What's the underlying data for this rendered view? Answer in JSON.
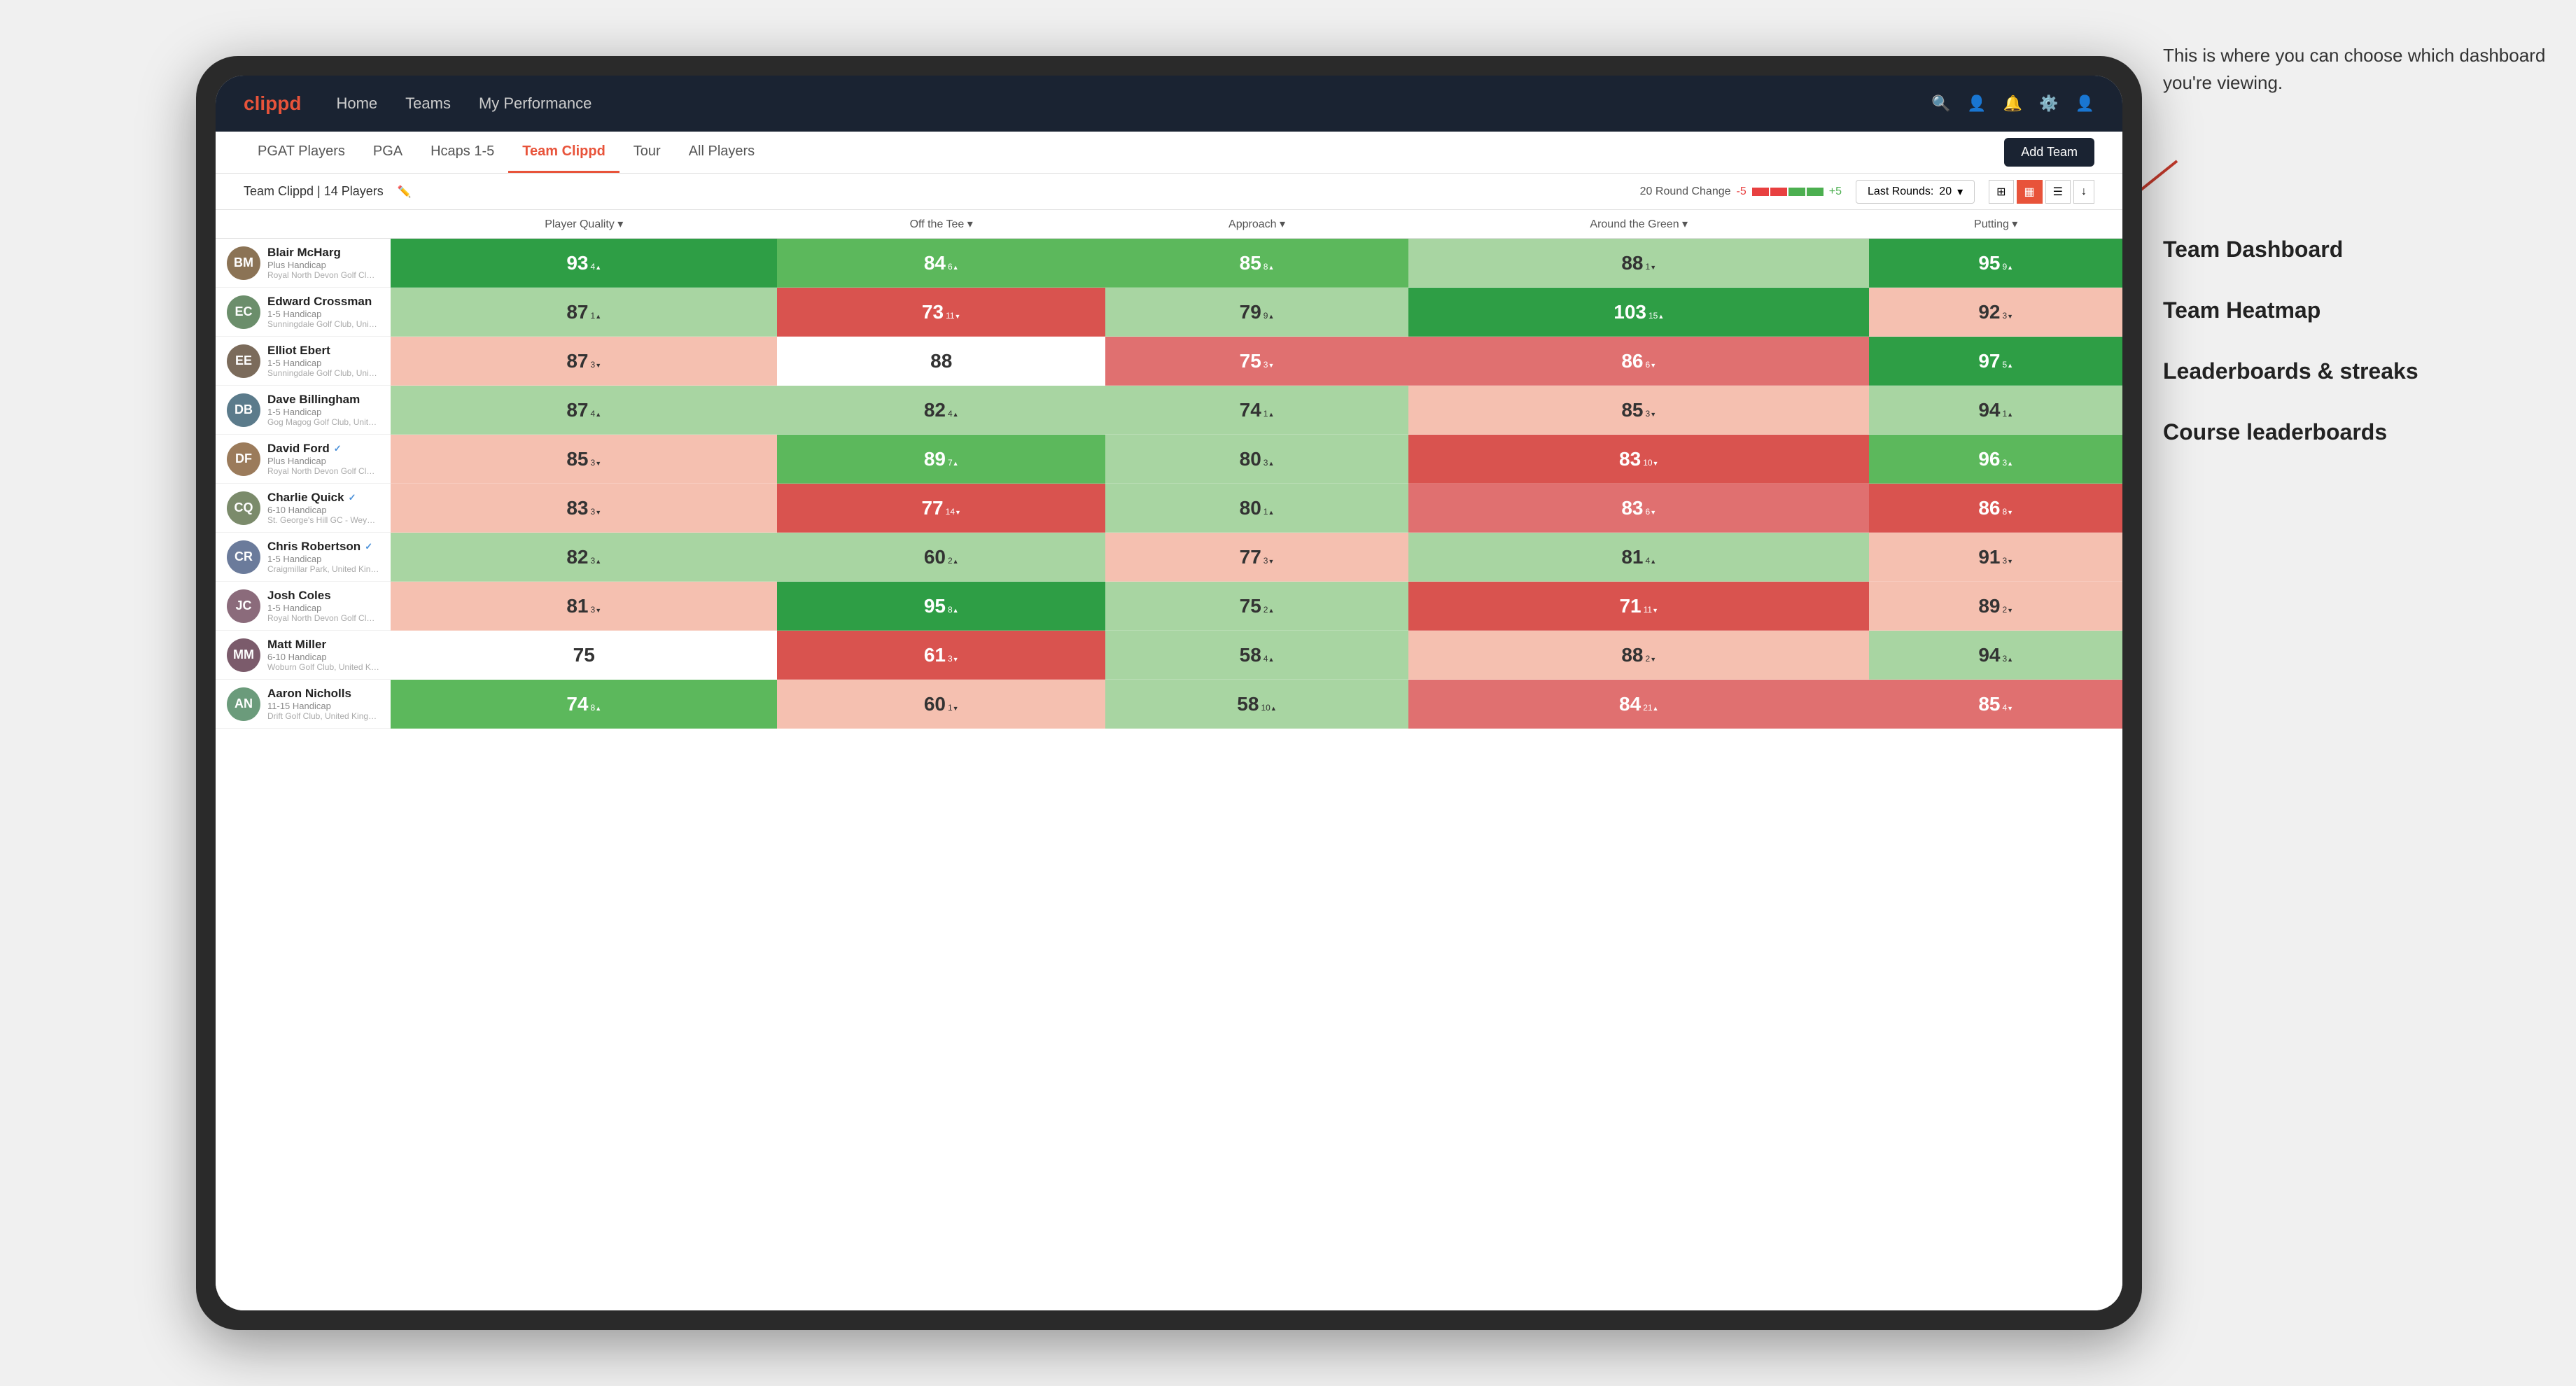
{
  "annotation": {
    "description": "This is where you can choose which dashboard you're viewing.",
    "options": [
      "Team Dashboard",
      "Team Heatmap",
      "Leaderboards & streaks",
      "Course leaderboards"
    ]
  },
  "nav": {
    "logo": "clippd",
    "links": [
      "Home",
      "Teams",
      "My Performance"
    ],
    "icons": [
      "search",
      "person",
      "bell",
      "settings",
      "account"
    ]
  },
  "tabs": [
    {
      "label": "PGAT Players",
      "active": false
    },
    {
      "label": "PGA",
      "active": false
    },
    {
      "label": "Hcaps 1-5",
      "active": false
    },
    {
      "label": "Team Clippd",
      "active": true
    },
    {
      "label": "Tour",
      "active": false
    },
    {
      "label": "All Players",
      "active": false
    }
  ],
  "add_team_label": "Add Team",
  "toolbar": {
    "team_name": "Team Clippd",
    "player_count": "14 Players",
    "round_change_label": "20 Round Change",
    "minus_label": "-5",
    "plus_label": "+5",
    "last_rounds_label": "Last Rounds:",
    "last_rounds_value": "20"
  },
  "columns": [
    {
      "label": "Player Quality ▾",
      "key": "quality"
    },
    {
      "label": "Off the Tee ▾",
      "key": "off_tee"
    },
    {
      "label": "Approach ▾",
      "key": "approach"
    },
    {
      "label": "Around the Green ▾",
      "key": "around"
    },
    {
      "label": "Putting ▾",
      "key": "putting"
    }
  ],
  "players": [
    {
      "name": "Blair McHarg",
      "handicap": "Plus Handicap",
      "club": "Royal North Devon Golf Club, United Kingdom",
      "initials": "BM",
      "avatar_color": "#8B7355",
      "quality": {
        "value": 93,
        "change": 4,
        "trend": "up",
        "bg": "green-strong"
      },
      "off_tee": {
        "value": 84,
        "change": 6,
        "trend": "up",
        "bg": "green-mid"
      },
      "approach": {
        "value": 85,
        "change": 8,
        "trend": "up",
        "bg": "green-mid"
      },
      "around": {
        "value": 88,
        "change": 1,
        "trend": "down",
        "bg": "green-light"
      },
      "putting": {
        "value": 95,
        "change": 9,
        "trend": "up",
        "bg": "green-strong"
      }
    },
    {
      "name": "Edward Crossman",
      "handicap": "1-5 Handicap",
      "club": "Sunningdale Golf Club, United Kingdom",
      "initials": "EC",
      "avatar_color": "#6B8E6B",
      "quality": {
        "value": 87,
        "change": 1,
        "trend": "up",
        "bg": "green-light"
      },
      "off_tee": {
        "value": 73,
        "change": 11,
        "trend": "down",
        "bg": "red-strong"
      },
      "approach": {
        "value": 79,
        "change": 9,
        "trend": "up",
        "bg": "green-light"
      },
      "around": {
        "value": 103,
        "change": 15,
        "trend": "up",
        "bg": "green-strong"
      },
      "putting": {
        "value": 92,
        "change": 3,
        "trend": "down",
        "bg": "red-light"
      }
    },
    {
      "name": "Elliot Ebert",
      "handicap": "1-5 Handicap",
      "club": "Sunningdale Golf Club, United Kingdom",
      "initials": "EE",
      "avatar_color": "#7B6B5B",
      "quality": {
        "value": 87,
        "change": 3,
        "trend": "down",
        "bg": "red-light"
      },
      "off_tee": {
        "value": 88,
        "change": null,
        "trend": null,
        "bg": "white"
      },
      "approach": {
        "value": 75,
        "change": 3,
        "trend": "down",
        "bg": "red-mid"
      },
      "around": {
        "value": 86,
        "change": 6,
        "trend": "down",
        "bg": "red-mid"
      },
      "putting": {
        "value": 97,
        "change": 5,
        "trend": "up",
        "bg": "green-strong"
      }
    },
    {
      "name": "Dave Billingham",
      "handicap": "1-5 Handicap",
      "club": "Gog Magog Golf Club, United Kingdom",
      "initials": "DB",
      "avatar_color": "#5B7B8B",
      "quality": {
        "value": 87,
        "change": 4,
        "trend": "up",
        "bg": "green-light"
      },
      "off_tee": {
        "value": 82,
        "change": 4,
        "trend": "up",
        "bg": "green-light"
      },
      "approach": {
        "value": 74,
        "change": 1,
        "trend": "up",
        "bg": "green-light"
      },
      "around": {
        "value": 85,
        "change": 3,
        "trend": "down",
        "bg": "red-light"
      },
      "putting": {
        "value": 94,
        "change": 1,
        "trend": "up",
        "bg": "green-light"
      }
    },
    {
      "name": "David Ford",
      "handicap": "Plus Handicap",
      "club": "Royal North Devon Golf Club, United Kingdom",
      "initials": "DF",
      "avatar_color": "#9B7B5B",
      "verified": true,
      "quality": {
        "value": 85,
        "change": 3,
        "trend": "down",
        "bg": "red-light"
      },
      "off_tee": {
        "value": 89,
        "change": 7,
        "trend": "up",
        "bg": "green-mid"
      },
      "approach": {
        "value": 80,
        "change": 3,
        "trend": "up",
        "bg": "green-light"
      },
      "around": {
        "value": 83,
        "change": 10,
        "trend": "down",
        "bg": "red-strong"
      },
      "putting": {
        "value": 96,
        "change": 3,
        "trend": "up",
        "bg": "green-mid"
      }
    },
    {
      "name": "Charlie Quick",
      "handicap": "6-10 Handicap",
      "club": "St. George's Hill GC - Weybridge - Surrey, Uni...",
      "initials": "CQ",
      "avatar_color": "#7B8B6B",
      "verified": true,
      "quality": {
        "value": 83,
        "change": 3,
        "trend": "down",
        "bg": "red-light"
      },
      "off_tee": {
        "value": 77,
        "change": 14,
        "trend": "down",
        "bg": "red-strong"
      },
      "approach": {
        "value": 80,
        "change": 1,
        "trend": "up",
        "bg": "green-light"
      },
      "around": {
        "value": 83,
        "change": 6,
        "trend": "down",
        "bg": "red-mid"
      },
      "putting": {
        "value": 86,
        "change": 8,
        "trend": "down",
        "bg": "red-strong"
      }
    },
    {
      "name": "Chris Robertson",
      "handicap": "1-5 Handicap",
      "club": "Craigmillar Park, United Kingdom",
      "initials": "CR",
      "avatar_color": "#6B7B9B",
      "verified": true,
      "quality": {
        "value": 82,
        "change": 3,
        "trend": "up",
        "bg": "green-light"
      },
      "off_tee": {
        "value": 60,
        "change": 2,
        "trend": "up",
        "bg": "green-light"
      },
      "approach": {
        "value": 77,
        "change": 3,
        "trend": "down",
        "bg": "red-light"
      },
      "around": {
        "value": 81,
        "change": 4,
        "trend": "up",
        "bg": "green-light"
      },
      "putting": {
        "value": 91,
        "change": 3,
        "trend": "down",
        "bg": "red-light"
      }
    },
    {
      "name": "Josh Coles",
      "handicap": "1-5 Handicap",
      "club": "Royal North Devon Golf Club, United Kingdom",
      "initials": "JC",
      "avatar_color": "#8B6B7B",
      "quality": {
        "value": 81,
        "change": 3,
        "trend": "down",
        "bg": "red-light"
      },
      "off_tee": {
        "value": 95,
        "change": 8,
        "trend": "up",
        "bg": "green-strong"
      },
      "approach": {
        "value": 75,
        "change": 2,
        "trend": "up",
        "bg": "green-light"
      },
      "around": {
        "value": 71,
        "change": 11,
        "trend": "down",
        "bg": "red-strong"
      },
      "putting": {
        "value": 89,
        "change": 2,
        "trend": "down",
        "bg": "red-light"
      }
    },
    {
      "name": "Matt Miller",
      "handicap": "6-10 Handicap",
      "club": "Woburn Golf Club, United Kingdom",
      "initials": "MM",
      "avatar_color": "#7B5B6B",
      "quality": {
        "value": 75,
        "change": null,
        "trend": null,
        "bg": "white"
      },
      "off_tee": {
        "value": 61,
        "change": 3,
        "trend": "down",
        "bg": "red-strong"
      },
      "approach": {
        "value": 58,
        "change": 4,
        "trend": "up",
        "bg": "green-light"
      },
      "around": {
        "value": 88,
        "change": 2,
        "trend": "down",
        "bg": "red-light"
      },
      "putting": {
        "value": 94,
        "change": 3,
        "trend": "up",
        "bg": "green-light"
      }
    },
    {
      "name": "Aaron Nicholls",
      "handicap": "11-15 Handicap",
      "club": "Drift Golf Club, United Kingdom",
      "initials": "AN",
      "avatar_color": "#6B9B7B",
      "quality": {
        "value": 74,
        "change": 8,
        "trend": "up",
        "bg": "green-mid"
      },
      "off_tee": {
        "value": 60,
        "change": 1,
        "trend": "down",
        "bg": "red-light"
      },
      "approach": {
        "value": 58,
        "change": 10,
        "trend": "up",
        "bg": "green-light"
      },
      "around": {
        "value": 84,
        "change": 21,
        "trend": "up",
        "bg": "red-mid"
      },
      "putting": {
        "value": 85,
        "change": 4,
        "trend": "down",
        "bg": "red-mid"
      }
    }
  ]
}
